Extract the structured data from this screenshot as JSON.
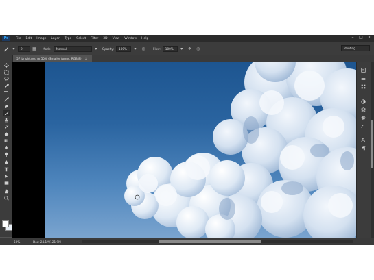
{
  "app": {
    "logo": "Ps"
  },
  "menu": [
    "File",
    "Edit",
    "Image",
    "Layer",
    "Type",
    "Select",
    "Filter",
    "3D",
    "View",
    "Window",
    "Help"
  ],
  "window_controls": {
    "minimize": "–",
    "maximize": "□",
    "close": "×"
  },
  "options": {
    "brush_size": "9",
    "mode_label": "Mode:",
    "mode_value": "Normal",
    "opacity_label": "Opacity:",
    "opacity_value": "100%",
    "flow_label": "Flow:",
    "flow_value": "100%",
    "workspace": "Painting"
  },
  "document": {
    "tab_title": "57_bright.psd @ 50% (Smaller forms, RGB/8)",
    "tab_close": "×"
  },
  "status": {
    "zoom": "50%",
    "doc_info": "Doc: 24.1M/121.9M"
  },
  "colors": {
    "sky_top": "#1d5590",
    "sky_bottom": "#7aa4cf",
    "cloud_light": "#eef3fa",
    "cloud_shadow": "#a9bfda",
    "foreground": "#ffffff",
    "background": "#e8eef5"
  },
  "icons": {
    "toolbar": [
      "move-icon",
      "marquee-icon",
      "lasso-icon",
      "quick-select-icon",
      "crop-icon",
      "eyedropper-icon",
      "healing-icon",
      "brush-icon",
      "clone-stamp-icon",
      "history-brush-icon",
      "eraser-icon",
      "gradient-icon",
      "blur-icon",
      "dodge-icon",
      "pen-icon",
      "type-icon",
      "path-select-icon",
      "rectangle-icon",
      "hand-icon",
      "zoom-icon"
    ],
    "right_panel": [
      "history-icon",
      "properties-icon",
      "swatches-icon",
      "adjustments-icon",
      "layers-icon",
      "channels-icon",
      "paths-icon",
      "character-icon",
      "paragraph-icon"
    ]
  }
}
